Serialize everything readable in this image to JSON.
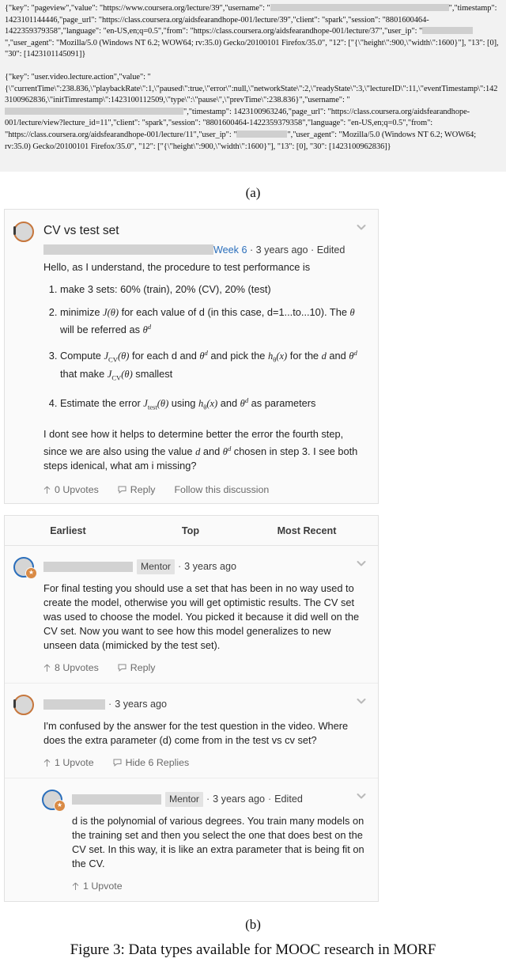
{
  "figure": {
    "sublabel_a": "(a)",
    "sublabel_b": "(b)",
    "caption": "Figure 3: Data types available for MOOC research in MORF"
  },
  "json_logs": {
    "record1_part1": "{\"key\": \"pageview\",\"value\": \"https://www.coursera.org/lecture/39\",\"username\": \"",
    "record1_part2": "\",\"timestamp\": 1423101144446,\"page_url\": \"https://class.coursera.org/aidsfearandhope-001/lecture/39\",\"client\": \"spark\",\"session\": \"8801600464-1422359379358\",\"language\": \"en-US,en;q=0.5\",\"from\": \"https://class.coursera.org/aidsfearandhope-001/lecture/37\",\"user_ip\": \"",
    "record1_part3": "\",\"user_agent\": \"Mozilla/5.0 (Windows NT 6.2; WOW64; rv:35.0) Gecko/20100101 Firefox/35.0\", \"12\": [\"{\\\"height\\\":900,\\\"width\\\":1600}\"], \"13\": [0], \"30\": [1423101145091]}",
    "record2_part1": "{\"key\": \"user.video.lecture.action\",\"value\": \"{\\\"currentTime\\\":238.836,\\\"playbackRate\\\":1,\\\"paused\\\":true,\\\"error\\\":null,\\\"networkState\\\":2,\\\"readyState\\\":3,\\\"lectureID\\\":11,\\\"eventTimestamp\\\":1423100962836,\\\"initTimrestamp\\\":1423100112509,\\\"type\\\":\\\"pause\\\",\\\"prevTime\\\":238.836}\",\"username\": \"",
    "record2_part2": "\",\"timestamp\": 1423100963246,\"page_url\": \"https://class.coursera.org/aidsfearandhope-001/lecture/view?lecture_id=11\",\"client\": \"spark\",\"session\": \"8801600464-1422359379358\",\"language\": \"en-US,en;q=0.5\",\"from\": \"https://class.coursera.org/aidsfearandhope-001/lecture/11\",\"user_ip\": \"",
    "record2_part3": "\",\"user_agent\": \"Mozilla/5.0 (Windows NT 6.2; WOW64; rv:35.0) Gecko/20100101 Firefox/35.0\", \"12\": [\"{\\\"height\\\":900,\\\"width\\\":1600}\"], \"13\": [0], \"30\": [1423100962836]}"
  },
  "forum": {
    "thread": {
      "title": "CV vs test set",
      "week_link": "Week 6",
      "meta_separator": "·",
      "timestamp": "3 years ago",
      "edited": "Edited",
      "intro": "Hello, as I understand, the procedure to test performance is",
      "steps": [
        "make 3 sets: 60% (train), 20% (CV), 20% (test)",
        "minimize J(θ) for each value of d (in this case, d=1...to...10). The θ will be referred as θᵈ",
        "Compute JCV(θ) for each d and θᵈ and pick the hθ(x) for the d and θᵈ that make JCV(θ) smallest",
        "Estimate the error Jtest(θ) using hθ(x) and θᵈ as parameters"
      ],
      "closing": "I dont see how it helps to determine better the error the fourth step, since we are also using the value d and θᵈ chosen in step 3. I see both steps idenical, what am i missing?",
      "actions": {
        "upvotes": "0 Upvotes",
        "reply": "Reply",
        "follow": "Follow this discussion"
      }
    },
    "sort_tabs": [
      {
        "label": "Earliest",
        "selected": false
      },
      {
        "label": "Top",
        "selected": false
      },
      {
        "label": "Most Recent",
        "selected": false
      }
    ],
    "replies": [
      {
        "badge": "Mentor",
        "timestamp": "3 years ago",
        "edited": "",
        "body": "For final testing you should use a set that has been in no way used to create the model, otherwise you will get optimistic results. The CV set was used to choose the model. You picked it because it did well on the CV set. Now you want to see how this model generalizes to new unseen data (mimicked by the test set).",
        "upvotes": "8 Upvotes",
        "reply": "Reply",
        "nested": false,
        "avatar_kind": "mentor"
      },
      {
        "badge": "",
        "timestamp": "3 years ago",
        "edited": "",
        "body": "I'm confused by the answer for the test question in the video. Where does the extra parameter (d) come from in the test vs cv set?",
        "upvotes": "1 Upvote",
        "reply": "Hide 6 Replies",
        "nested": false,
        "avatar_kind": "plain"
      },
      {
        "badge": "Mentor",
        "timestamp": "3 years ago",
        "edited": "Edited",
        "body": "d is the polynomial of various degrees. You train many models on the training set and then you select the one that does best on the CV set. In this way, it is like an extra parameter that is being fit on the CV.",
        "upvotes": "1 Upvote",
        "reply": "",
        "nested": true,
        "avatar_kind": "mentor"
      }
    ]
  },
  "colors": {
    "link": "#2a6ebb",
    "mentor_ring": "#2a6ebb",
    "avatar_ring": "#c6763c",
    "panel_bg": "#f2f2f2",
    "card_bg": "#fafafa",
    "redaction": "#cfcfcf"
  }
}
